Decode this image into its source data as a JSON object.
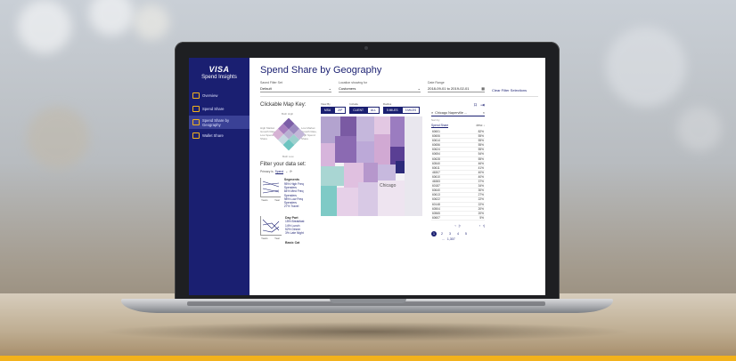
{
  "app": {
    "logo": "VISA",
    "title": "Spend Insights",
    "page_title": "Spend Share by Geography"
  },
  "sidebar": {
    "items": [
      {
        "label": "Overview",
        "active": false
      },
      {
        "label": "Spend Share",
        "active": false
      },
      {
        "label": "Spend Share by Geography",
        "active": true
      },
      {
        "label": "Wallet Share",
        "active": false
      }
    ]
  },
  "filters": {
    "filter_set_label": "Saved Filter Set",
    "filter_set_value": "Default",
    "showing_label": "Location showing for",
    "showing_value": "Customers",
    "date_label": "Date Range",
    "date_value": "2018-09-01 to 2019-02-01",
    "clear_label": "Clear Filter Selections"
  },
  "map_key": {
    "heading": "Clickable Map Key:",
    "top": "Both High",
    "left": "High Market Growth Rate, Low Spend Share",
    "right": "Low Market Growth Rate, High Spend Share",
    "bottom": "Both Low"
  },
  "filter_data": {
    "heading": "Filter your data set:",
    "primary_label": "Primary is",
    "primary_value": "Spend",
    "segments": {
      "title": "Segments",
      "items": [
        "95% High Freq Spenders",
        "84% Med Freq Spenders",
        "98% Low Freq Spenders",
        "27% Travel"
      ]
    },
    "dayparts": {
      "title": "Day Part",
      "items": [
        "15% Breakfast",
        "14% Lunch",
        "52% Dinner",
        "3% Late Night"
      ]
    },
    "chart1_labels": [
      "Years",
      "Year"
    ],
    "chart2_labels": [
      "Years",
      "Year"
    ],
    "next_title": "Basic Cat"
  },
  "view": {
    "view_by_label": "View By",
    "view_by": [
      "MSA",
      "ZIP"
    ],
    "include_label": "Include",
    "include": [
      "CLIENT",
      "ALL"
    ],
    "radius_label": "Radius",
    "radius": [
      "5 MILES",
      "3 MILES"
    ]
  },
  "map": {
    "city_label": "Chicago"
  },
  "list": {
    "search_value": "Chicago Naperville ...",
    "sort_label": "Sort by",
    "sort_value": "Spend Share",
    "order_value": "desc",
    "rows": [
      {
        "zip": "60601",
        "val": "82%"
      },
      {
        "zip": "60606",
        "val": "55%"
      },
      {
        "zip": "60614",
        "val": "55%"
      },
      {
        "zip": "60656",
        "val": "55%"
      },
      {
        "zip": "60624",
        "val": "55%"
      },
      {
        "zip": "60654",
        "val": "54%"
      },
      {
        "zip": "60628",
        "val": "55%"
      },
      {
        "zip": "60540",
        "val": "46%"
      },
      {
        "zip": "60611",
        "val": "41%"
      },
      {
        "zip": "46307",
        "val": "40%"
      },
      {
        "zip": "60610",
        "val": "40%"
      },
      {
        "zip": "46383",
        "val": "37%"
      },
      {
        "zip": "60187",
        "val": "34%"
      },
      {
        "zip": "60640",
        "val": "30%"
      },
      {
        "zip": "60613",
        "val": "27%"
      },
      {
        "zip": "60622",
        "val": "22%"
      },
      {
        "zip": "60148",
        "val": "22%"
      },
      {
        "zip": "60504",
        "val": "20%"
      },
      {
        "zip": "60565",
        "val": "20%"
      },
      {
        "zip": "60607",
        "val": "5%"
      }
    ],
    "pages": [
      "1",
      "2",
      "3",
      "4",
      "5"
    ],
    "last_page": "1,307",
    "ellipsis": "..."
  }
}
